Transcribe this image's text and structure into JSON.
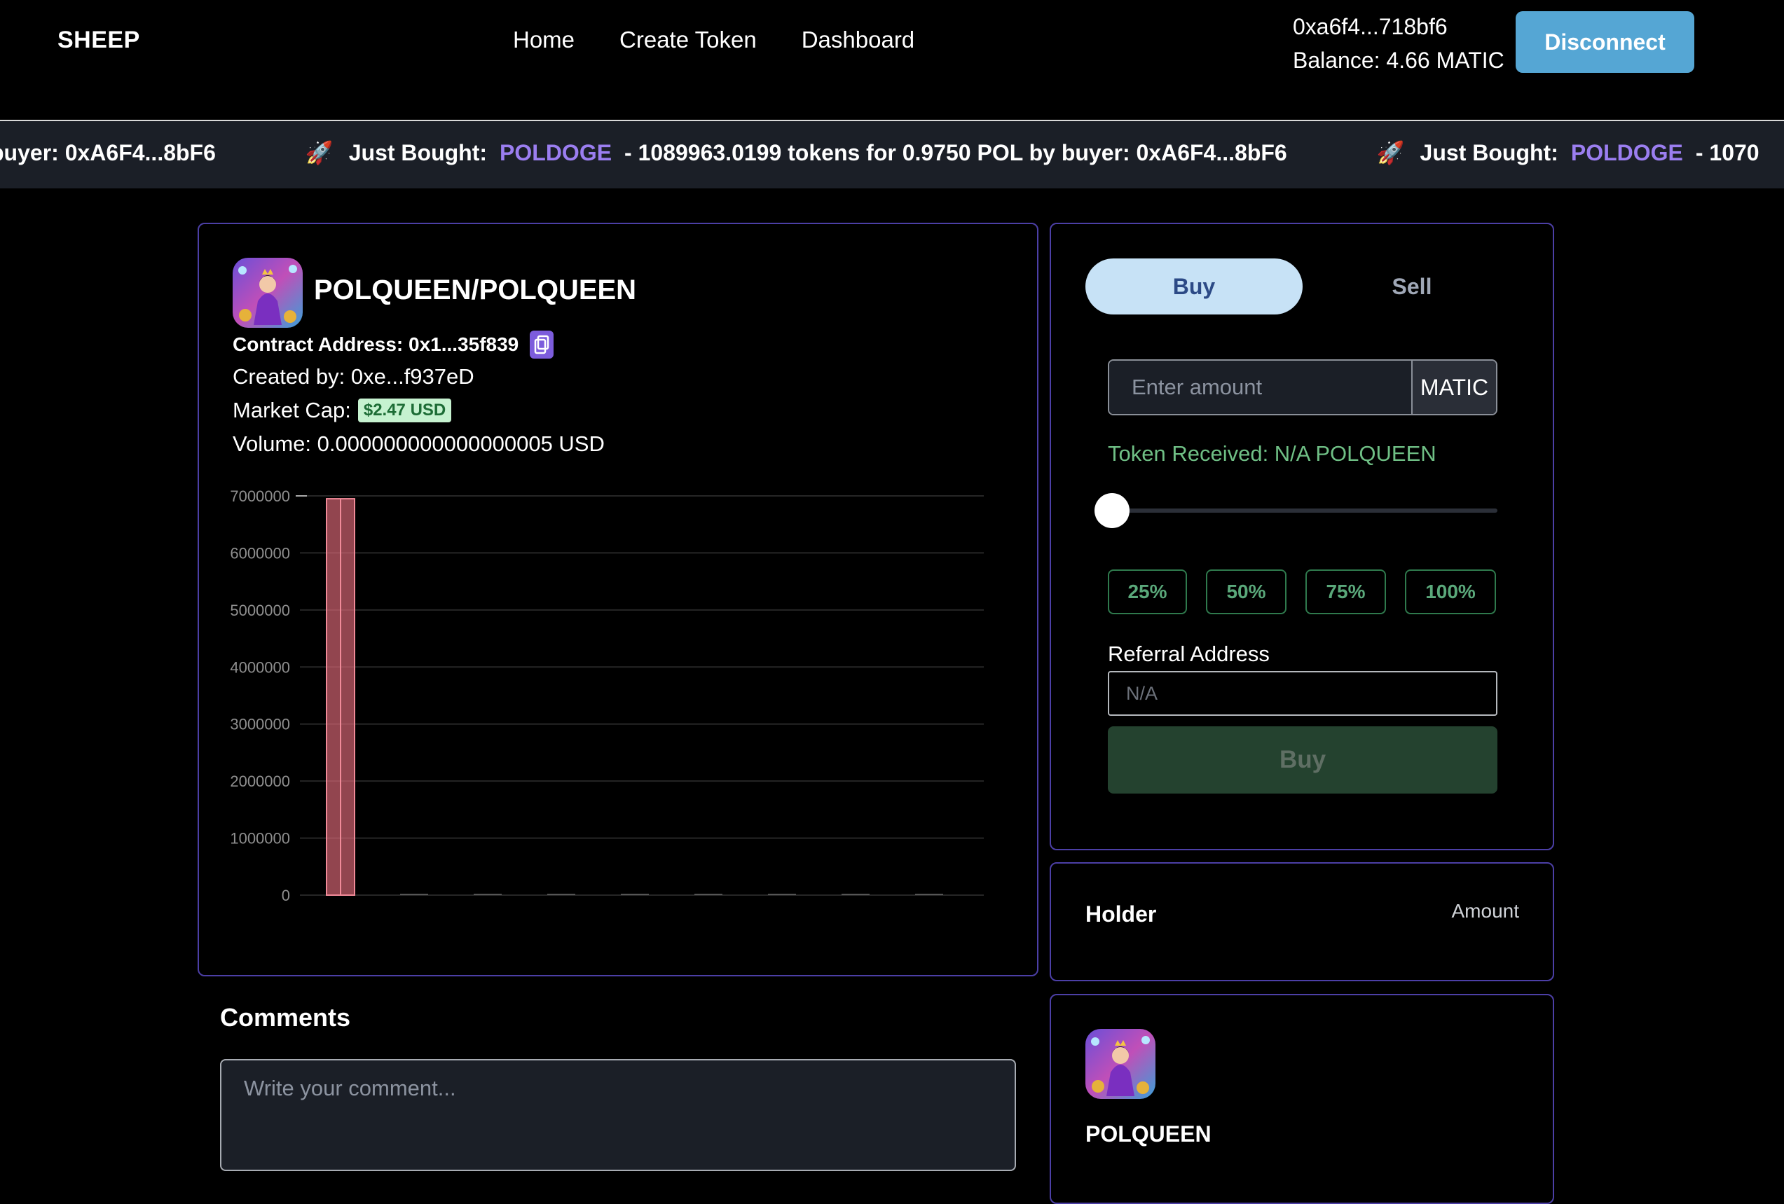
{
  "header": {
    "brand": "SHEEP",
    "nav": [
      "Home",
      "Create Token",
      "Dashboard"
    ],
    "wallet_address": "0xa6f4...718bf6",
    "balance": "Balance: 4.66 MATIC",
    "disconnect_label": "Disconnect"
  },
  "ticker": {
    "lead_text": "buyer: 0xA6F4...8bF6",
    "items": [
      {
        "label": "Just Bought:",
        "symbol": "POLDOGE",
        "detail": "- 1089963.0199 tokens for 0.9750 POL by buyer: 0xA6F4...8bF6"
      },
      {
        "label": "Just Bought:",
        "symbol": "POLDOGE",
        "detail": "- 1070"
      }
    ]
  },
  "token": {
    "title": "POLQUEEN/POLQUEEN",
    "contract": "Contract Address: 0x1...35f839",
    "created_by": "Created by: 0xe...f937eD",
    "market_cap_label": "Market Cap:",
    "market_cap_value": "$2.47 USD",
    "volume": "Volume: 0.000000000000000005 USD"
  },
  "chart_data": {
    "type": "bar",
    "ylim": [
      0,
      7000000
    ],
    "y_ticks": [
      "0",
      "1000000",
      "2000000",
      "3000000",
      "4000000",
      "5000000",
      "6000000",
      "7000000"
    ],
    "values": [
      6950000,
      0,
      0,
      0,
      0,
      0,
      0,
      0,
      0
    ],
    "bar_color": "#e06a7a",
    "grid": true
  },
  "trade": {
    "tab_buy": "Buy",
    "tab_sell": "Sell",
    "amount_placeholder": "Enter amount",
    "amount_unit": "MATIC",
    "received": "Token Received: N/A POLQUEEN",
    "slider_percent": 0,
    "percent_buttons": [
      "25%",
      "50%",
      "75%",
      "100%"
    ],
    "referral_label": "Referral Address",
    "referral_placeholder": "N/A",
    "buy_label": "Buy"
  },
  "holders": {
    "holder_header": "Holder",
    "amount_header": "Amount"
  },
  "token_info": {
    "name": "POLQUEEN"
  },
  "comments": {
    "heading": "Comments",
    "placeholder": "Write your comment..."
  }
}
